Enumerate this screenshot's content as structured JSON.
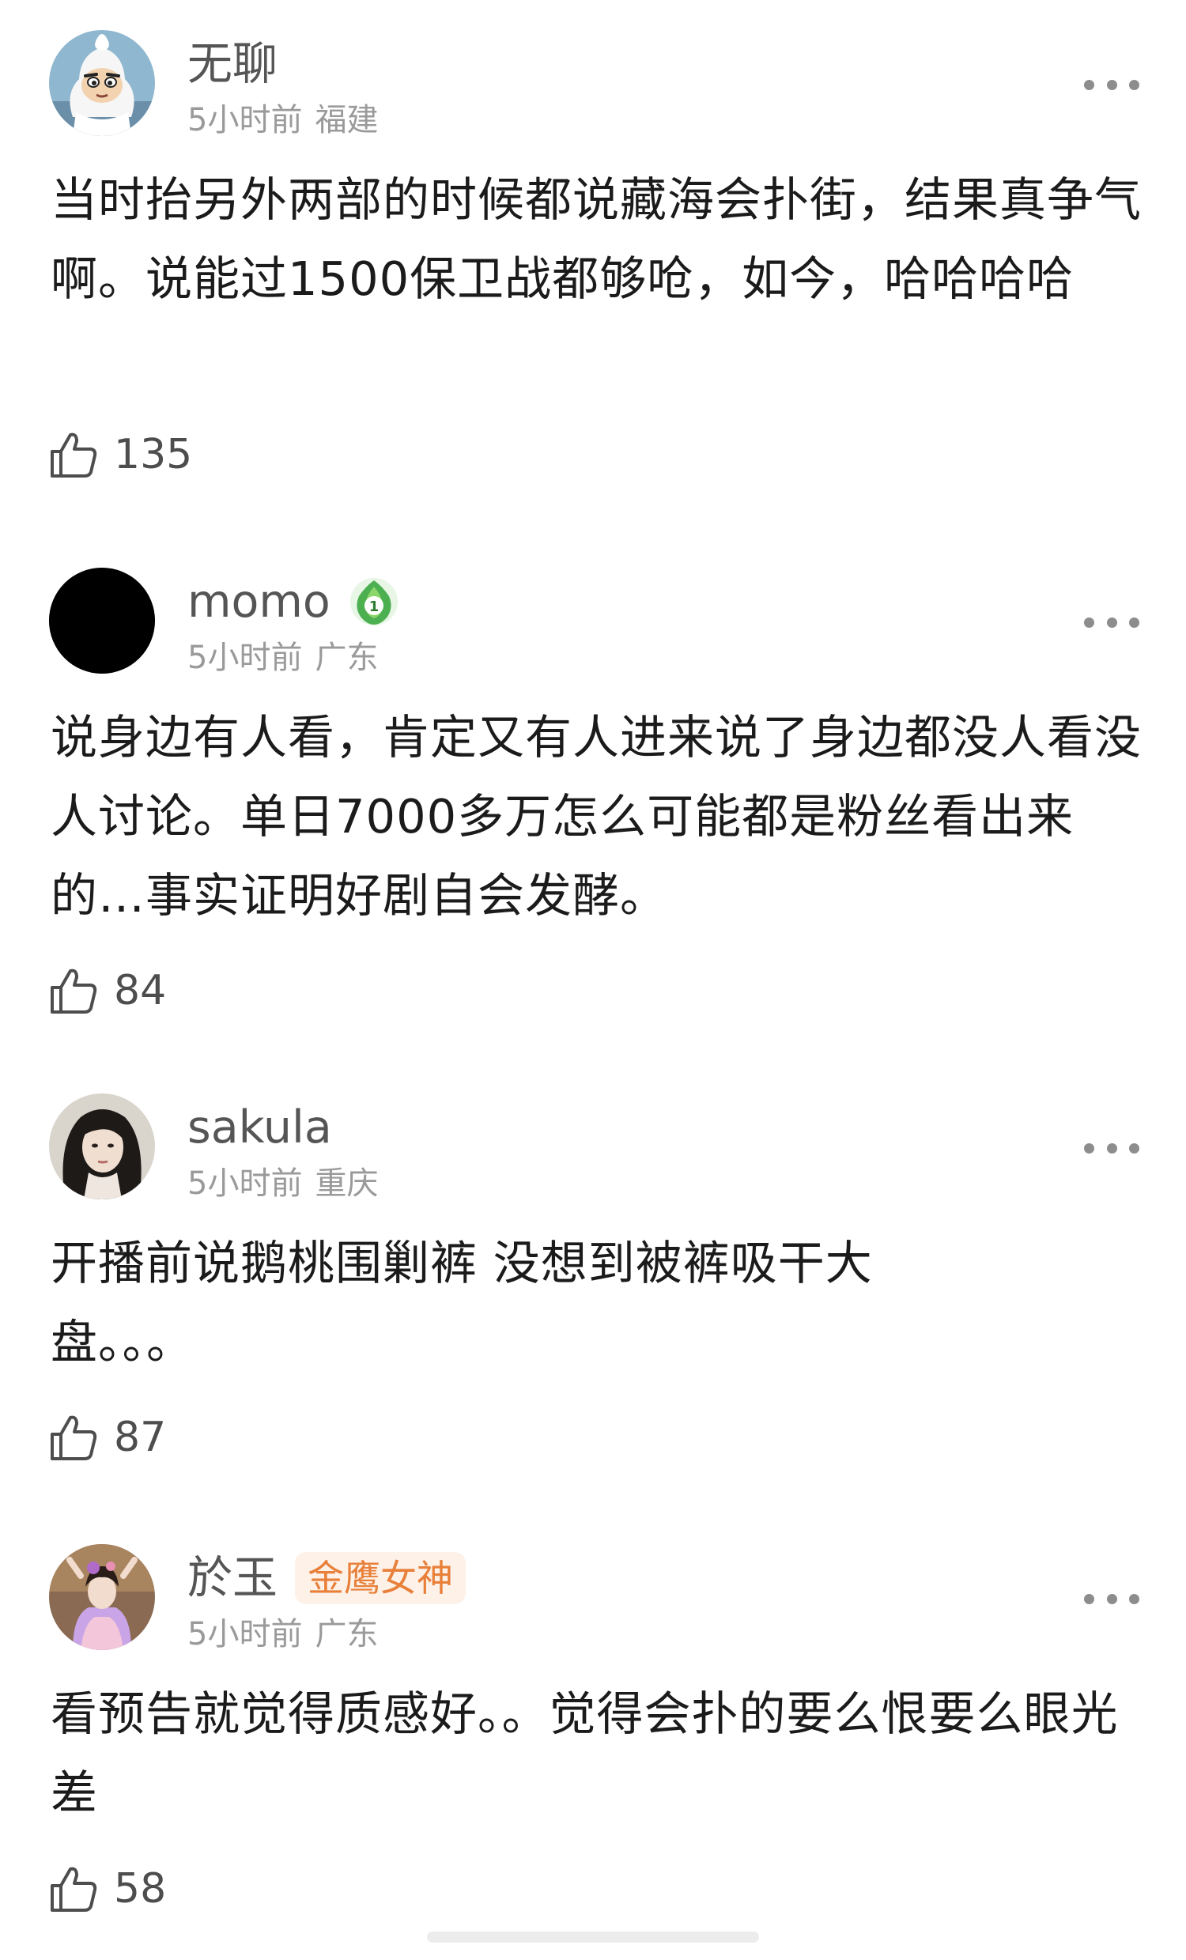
{
  "comments": [
    {
      "username": "无聊",
      "time": "5小时前",
      "location": "福建",
      "text": "当时抬另外两部的时候都说藏海会扑街，结果真争气啊。说能过1500保卫战都够呛，如今，哈哈哈哈",
      "likes": "135",
      "avatar_icon": "cartoon-avatar"
    },
    {
      "username": "momo",
      "time": "5小时前",
      "location": "广东",
      "text": "说身边有人看，肯定又有人进来说了身边都没人看没人讨论。单日7000多万怎么可能都是粉丝看出来的…事实证明好剧自会发酵。",
      "likes": "84",
      "avatar_icon": "black-circle-avatar",
      "badge_icon": "green-level-badge-icon",
      "badge_level": "1",
      "badge_color": "#4caf50"
    },
    {
      "username": "sakula",
      "time": "5小时前",
      "location": "重庆",
      "text": "开播前说鹅桃围剿裤 没想到被裤吸干大盘。。。",
      "likes": "87",
      "avatar_icon": "portrait-avatar"
    },
    {
      "username": "於玉",
      "time": "5小时前",
      "location": "广东",
      "text": "看预告就觉得质感好。。觉得会扑的要么恨要么眼光差",
      "likes": "58",
      "avatar_icon": "photo-avatar",
      "badge_text": "金鹰女神",
      "badge_color": "#e8803a",
      "badge_bg": "#fdf1e8"
    }
  ],
  "colors": {
    "username": "#555555",
    "meta": "#9a9a9a",
    "text": "#1b1b1b",
    "like": "#4d4d4d"
  }
}
